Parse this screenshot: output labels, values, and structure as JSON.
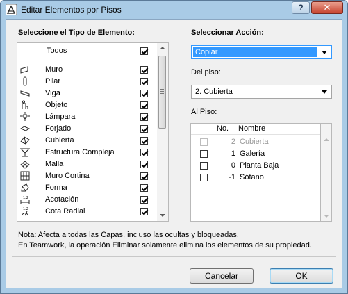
{
  "window": {
    "title": "Editar Elementos por Pisos",
    "help": "?",
    "close": "✕"
  },
  "left": {
    "heading": "Seleccione el Tipo de Elemento:",
    "all_label": "Todos",
    "all_checked": true,
    "items": [
      {
        "label": "Muro",
        "icon": "wall-icon",
        "checked": true
      },
      {
        "label": "Pilar",
        "icon": "column-icon",
        "checked": true
      },
      {
        "label": "Viga",
        "icon": "beam-icon",
        "checked": true
      },
      {
        "label": "Objeto",
        "icon": "object-icon",
        "checked": true
      },
      {
        "label": "Lámpara",
        "icon": "lamp-icon",
        "checked": true
      },
      {
        "label": "Forjado",
        "icon": "slab-icon",
        "checked": true
      },
      {
        "label": "Cubierta",
        "icon": "roof-icon",
        "checked": true
      },
      {
        "label": "Estructura Compleja",
        "icon": "complex-structure-icon",
        "checked": true
      },
      {
        "label": "Malla",
        "icon": "mesh-icon",
        "checked": true
      },
      {
        "label": "Muro Cortina",
        "icon": "curtain-wall-icon",
        "checked": true
      },
      {
        "label": "Forma",
        "icon": "morph-icon",
        "checked": true
      },
      {
        "label": "Acotación",
        "icon": "dimension-icon",
        "checked": true
      },
      {
        "label": "Cota Radial",
        "icon": "radial-dimension-icon",
        "checked": true
      }
    ]
  },
  "right": {
    "action_heading": "Seleccionar Acción:",
    "action_value": "Copiar",
    "from_label": "Del piso:",
    "from_value": "2. Cubierta",
    "to_label": "Al Piso:",
    "table_headers": {
      "no": "No.",
      "name": "Nombre"
    },
    "stories": [
      {
        "no": "2",
        "name": "Cubierta",
        "disabled": true,
        "checked": false
      },
      {
        "no": "1",
        "name": "Galería",
        "disabled": false,
        "checked": false
      },
      {
        "no": "0",
        "name": "Planta Baja",
        "disabled": false,
        "checked": false
      },
      {
        "no": "-1",
        "name": "Sótano",
        "disabled": false,
        "checked": false
      }
    ]
  },
  "notes": {
    "line1": "Nota: Afecta a todas las Capas, incluso las ocultas y bloqueadas.",
    "line2": "En Teamwork, la operación Eliminar solamente elimina los elementos de su propiedad."
  },
  "buttons": {
    "cancel": "Cancelar",
    "ok": "OK"
  },
  "colors": {
    "selection": "#3399ff",
    "title_bar": "#a9cbe6",
    "close": "#c7432e"
  }
}
